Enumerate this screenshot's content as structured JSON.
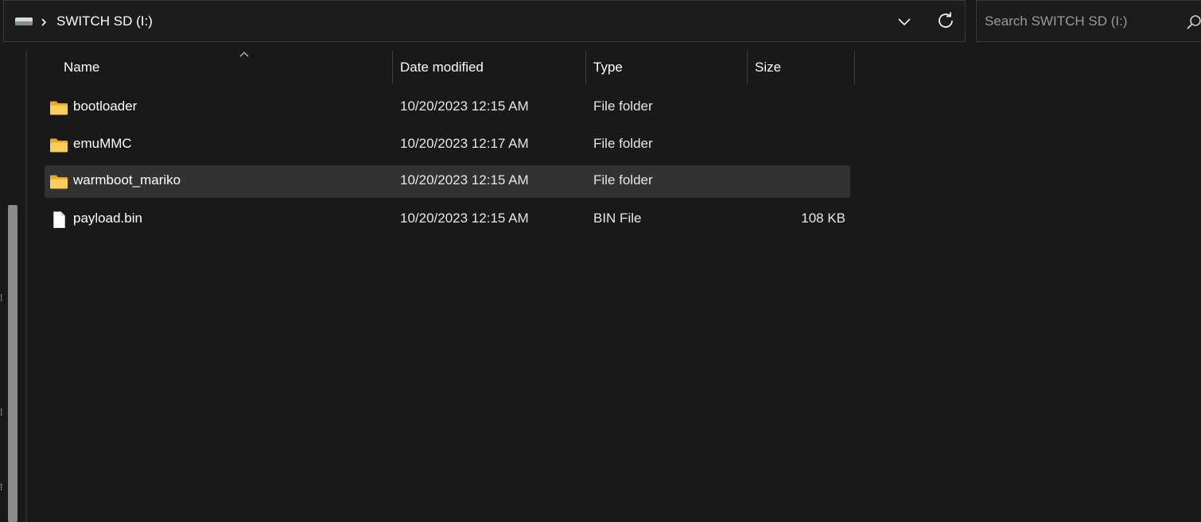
{
  "address": {
    "drive_icon": "drive-icon",
    "chevron_icon": "chevron-right-icon",
    "breadcrumb": "SWITCH SD (I:)",
    "dropdown_icon": "chevron-down-icon",
    "refresh_icon": "refresh-icon"
  },
  "search": {
    "placeholder": "Search SWITCH SD (I:)",
    "icon": "search-icon"
  },
  "columns": {
    "name": "Name",
    "date_modified": "Date modified",
    "type": "Type",
    "size": "Size",
    "sort_indicator_icon": "sort-ascending-icon"
  },
  "files": [
    {
      "name": "bootloader",
      "date": "10/20/2023 12:15 AM",
      "type": "File folder",
      "size": "",
      "icon": "folder-icon",
      "selected": false
    },
    {
      "name": "emuMMC",
      "date": "10/20/2023 12:17 AM",
      "type": "File folder",
      "size": "",
      "icon": "folder-icon",
      "selected": false
    },
    {
      "name": "warmboot_mariko",
      "date": "10/20/2023 12:15 AM",
      "type": "File folder",
      "size": "",
      "icon": "folder-icon",
      "selected": true
    },
    {
      "name": "payload.bin",
      "date": "10/20/2023 12:15 AM",
      "type": "BIN File",
      "size": "108 KB",
      "icon": "file-icon",
      "selected": false
    }
  ],
  "colors": {
    "background": "#191919",
    "selected_row": "#323232",
    "folder_yellow": "#f4c542"
  }
}
